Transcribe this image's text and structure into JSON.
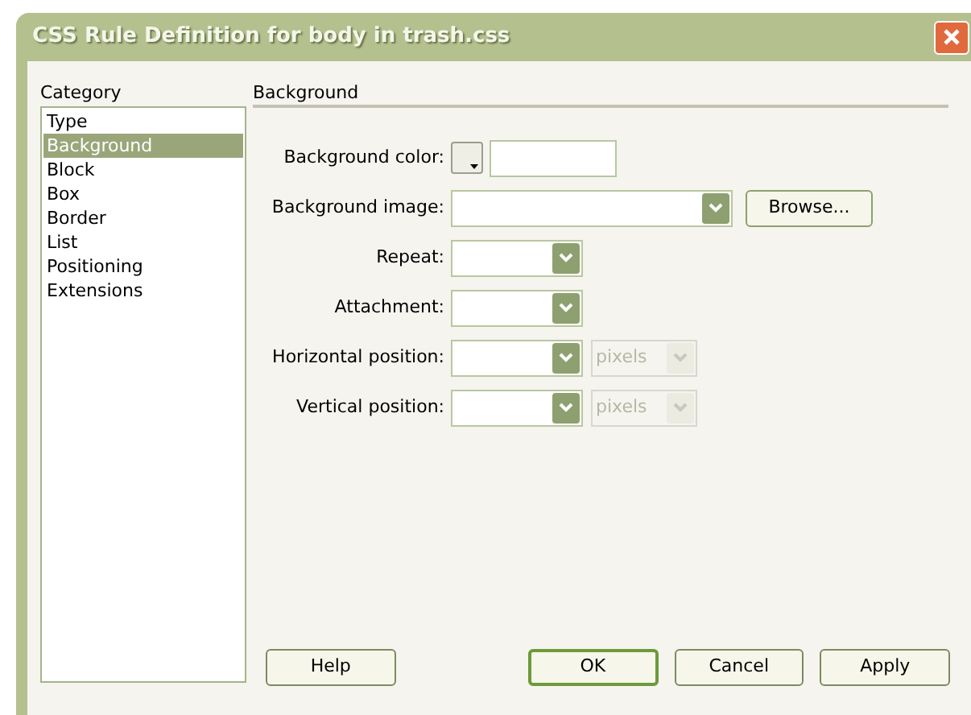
{
  "window": {
    "title": "CSS Rule Definition for body in trash.css"
  },
  "category": {
    "label": "Category",
    "items": [
      {
        "label": "Type",
        "selected": false
      },
      {
        "label": "Background",
        "selected": true
      },
      {
        "label": "Block",
        "selected": false
      },
      {
        "label": "Box",
        "selected": false
      },
      {
        "label": "Border",
        "selected": false
      },
      {
        "label": "List",
        "selected": false
      },
      {
        "label": "Positioning",
        "selected": false
      },
      {
        "label": "Extensions",
        "selected": false
      }
    ]
  },
  "panel": {
    "heading": "Background",
    "fields": [
      {
        "kind": "color",
        "label": "Background color:"
      },
      {
        "kind": "file",
        "label": "Background image:",
        "button": "Browse..."
      },
      {
        "kind": "select",
        "label": "Repeat:"
      },
      {
        "kind": "select",
        "label": "Attachment:"
      },
      {
        "kind": "unit",
        "label": "Horizontal position:",
        "unit": "pixels",
        "unit_disabled": true
      },
      {
        "kind": "unit",
        "label": "Vertical position:",
        "unit": "pixels",
        "unit_disabled": true
      }
    ]
  },
  "buttons": [
    {
      "label": "Help",
      "default": false
    },
    {
      "label": "OK",
      "default": true
    },
    {
      "label": "Cancel",
      "default": false
    },
    {
      "label": "Apply",
      "default": false
    }
  ]
}
